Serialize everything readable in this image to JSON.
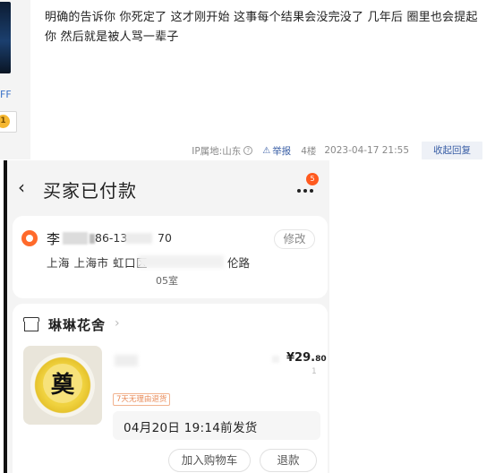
{
  "forum_post": {
    "user_link_fragment": "FF",
    "level_badge": "1",
    "body": "明确的告诉你 你死定了 这才刚开始 这事每个结果会没完没了 几年后 圈里也会提起你 然后就是被人骂一辈子",
    "ip_location": "IP属地:山东",
    "report_label": "举报",
    "floor": "4楼",
    "timestamp": "2023-04-17 21:55",
    "reply_button": "收起回复"
  },
  "phone_screen": {
    "title": "买家已付款",
    "message_badge": "5",
    "address": {
      "name_prefix": "李",
      "phone_part_1": "86-13",
      "phone_part_2": "70",
      "edit_button": "修改",
      "line1": "上海 上海市 虹口区",
      "road_suffix": "伦路",
      "room_fragment": "05室"
    },
    "order": {
      "shop_name": "琳琳花舍",
      "product_image_char": "奠",
      "price_main": "¥29.",
      "price_cents": "80",
      "quantity": "1",
      "return_tag": "7天无理由退货",
      "ship_notice": "04月20日 19:14前发货",
      "add_to_cart_button": "加入购物车",
      "refund_button": "退款"
    }
  },
  "colors": {
    "link_blue": "#3a5fa6",
    "accent_orange": "#ff6a2b",
    "tag_orange": "#e88a57"
  }
}
